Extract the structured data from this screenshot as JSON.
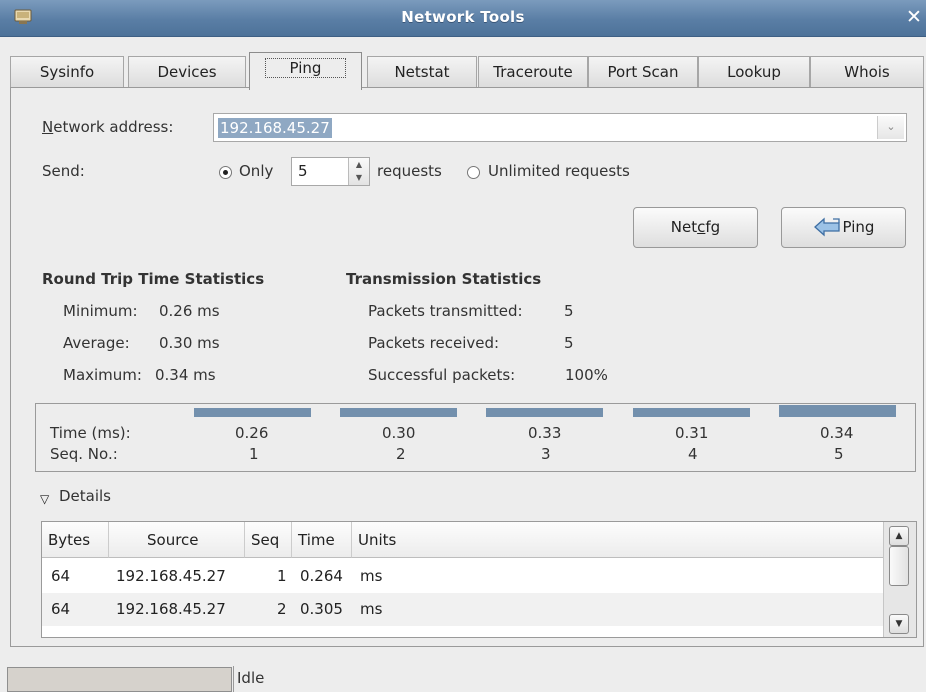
{
  "window": {
    "title": "Network Tools"
  },
  "tabs": [
    {
      "label": "Sysinfo"
    },
    {
      "label": "Devices"
    },
    {
      "label": "Ping"
    },
    {
      "label": "Netstat"
    },
    {
      "label": "Traceroute"
    },
    {
      "label": "Port Scan"
    },
    {
      "label": "Lookup"
    },
    {
      "label": "Whois"
    }
  ],
  "active_tab": "Ping",
  "form": {
    "address_label_mnemonic": "N",
    "address_label_rest": "etwork address:",
    "address_value": "192.168.45.27",
    "send_label": "Send:",
    "only_label": "Only",
    "count_value": "5",
    "requests_label": "requests",
    "unlimited_label": "Unlimited requests",
    "selected_option": "only"
  },
  "buttons": {
    "netcfg_pre": "Net",
    "netcfg_mnemonic": "c",
    "netcfg_post": "fg",
    "ping": "Ping"
  },
  "rtt": {
    "heading": "Round Trip Time Statistics",
    "minimum_label": "Minimum:",
    "minimum_value": "0.26 ms",
    "average_label": "Average:",
    "average_value": "0.30 ms",
    "maximum_label": "Maximum:",
    "maximum_value": "0.34 ms"
  },
  "tx": {
    "heading": "Transmission Statistics",
    "transmitted_label": "Packets transmitted:",
    "transmitted_value": "5",
    "received_label": "Packets received:",
    "received_value": "5",
    "success_label": "Successful packets:",
    "success_value": "100%"
  },
  "graph": {
    "time_label": "Time (ms):",
    "seq_label": "Seq. No.:",
    "columns": [
      {
        "time": "0.26",
        "seq": "1"
      },
      {
        "time": "0.30",
        "seq": "2"
      },
      {
        "time": "0.33",
        "seq": "3"
      },
      {
        "time": "0.31",
        "seq": "4"
      },
      {
        "time": "0.34",
        "seq": "5"
      }
    ]
  },
  "details": {
    "label": "Details",
    "headers": [
      "Bytes",
      "Source",
      "Seq",
      "Time",
      "Units"
    ],
    "rows": [
      {
        "bytes": "64",
        "source": "192.168.45.27",
        "seq": "1",
        "time": "0.264",
        "units": "ms"
      },
      {
        "bytes": "64",
        "source": "192.168.45.27",
        "seq": "2",
        "time": "0.305",
        "units": "ms"
      }
    ]
  },
  "status": {
    "text": "Idle"
  },
  "colors": {
    "titlebar": "#5a7ea5",
    "bar": "#7390ad",
    "selection": "#8fa8c3"
  }
}
